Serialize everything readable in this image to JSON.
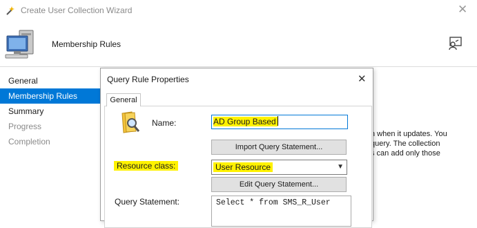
{
  "window": {
    "title": "Create User Collection Wizard",
    "close_glyph": "✕"
  },
  "header": {
    "title": "Membership Rules",
    "icon": "computer-icon",
    "help_icon": "help-icon"
  },
  "nav": {
    "items": [
      {
        "label": "General"
      },
      {
        "label": "Membership Rules"
      },
      {
        "label": "Summary"
      },
      {
        "label": "Progress"
      },
      {
        "label": "Completion"
      }
    ]
  },
  "background_text": {
    "lines": [
      "n when it updates. You",
      "query. The collection",
      "s can add only those"
    ]
  },
  "dialog": {
    "title": "Query Rule Properties",
    "close_glyph": "✕",
    "tab": "General",
    "name_label": "Name:",
    "name_value": "AD Group Based",
    "import_button": "Import Query Statement...",
    "resource_class_label": "Resource class:",
    "resource_class_value": "User Resource",
    "edit_button": "Edit Query Statement...",
    "query_label": "Query Statement:",
    "query_value": "Select * from SMS_R_User",
    "highlight_color": "#fff200"
  },
  "colors": {
    "accent": "#0078d7",
    "highlight": "#fff200"
  }
}
